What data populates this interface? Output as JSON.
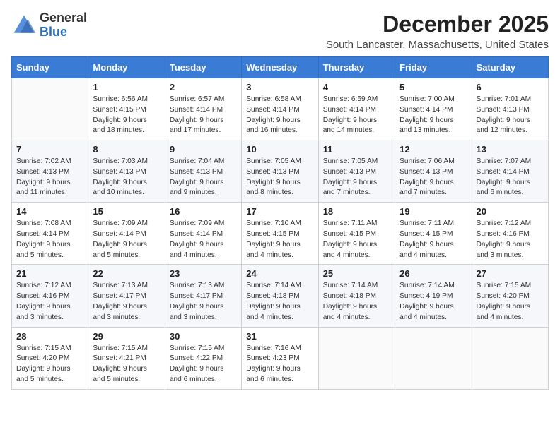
{
  "header": {
    "logo_general": "General",
    "logo_blue": "Blue",
    "month": "December 2025",
    "location": "South Lancaster, Massachusetts, United States"
  },
  "days_of_week": [
    "Sunday",
    "Monday",
    "Tuesday",
    "Wednesday",
    "Thursday",
    "Friday",
    "Saturday"
  ],
  "weeks": [
    [
      {
        "day": "",
        "sunrise": "",
        "sunset": "",
        "daylight": ""
      },
      {
        "day": "1",
        "sunrise": "Sunrise: 6:56 AM",
        "sunset": "Sunset: 4:15 PM",
        "daylight": "Daylight: 9 hours and 18 minutes."
      },
      {
        "day": "2",
        "sunrise": "Sunrise: 6:57 AM",
        "sunset": "Sunset: 4:14 PM",
        "daylight": "Daylight: 9 hours and 17 minutes."
      },
      {
        "day": "3",
        "sunrise": "Sunrise: 6:58 AM",
        "sunset": "Sunset: 4:14 PM",
        "daylight": "Daylight: 9 hours and 16 minutes."
      },
      {
        "day": "4",
        "sunrise": "Sunrise: 6:59 AM",
        "sunset": "Sunset: 4:14 PM",
        "daylight": "Daylight: 9 hours and 14 minutes."
      },
      {
        "day": "5",
        "sunrise": "Sunrise: 7:00 AM",
        "sunset": "Sunset: 4:14 PM",
        "daylight": "Daylight: 9 hours and 13 minutes."
      },
      {
        "day": "6",
        "sunrise": "Sunrise: 7:01 AM",
        "sunset": "Sunset: 4:13 PM",
        "daylight": "Daylight: 9 hours and 12 minutes."
      }
    ],
    [
      {
        "day": "7",
        "sunrise": "Sunrise: 7:02 AM",
        "sunset": "Sunset: 4:13 PM",
        "daylight": "Daylight: 9 hours and 11 minutes."
      },
      {
        "day": "8",
        "sunrise": "Sunrise: 7:03 AM",
        "sunset": "Sunset: 4:13 PM",
        "daylight": "Daylight: 9 hours and 10 minutes."
      },
      {
        "day": "9",
        "sunrise": "Sunrise: 7:04 AM",
        "sunset": "Sunset: 4:13 PM",
        "daylight": "Daylight: 9 hours and 9 minutes."
      },
      {
        "day": "10",
        "sunrise": "Sunrise: 7:05 AM",
        "sunset": "Sunset: 4:13 PM",
        "daylight": "Daylight: 9 hours and 8 minutes."
      },
      {
        "day": "11",
        "sunrise": "Sunrise: 7:05 AM",
        "sunset": "Sunset: 4:13 PM",
        "daylight": "Daylight: 9 hours and 7 minutes."
      },
      {
        "day": "12",
        "sunrise": "Sunrise: 7:06 AM",
        "sunset": "Sunset: 4:13 PM",
        "daylight": "Daylight: 9 hours and 7 minutes."
      },
      {
        "day": "13",
        "sunrise": "Sunrise: 7:07 AM",
        "sunset": "Sunset: 4:14 PM",
        "daylight": "Daylight: 9 hours and 6 minutes."
      }
    ],
    [
      {
        "day": "14",
        "sunrise": "Sunrise: 7:08 AM",
        "sunset": "Sunset: 4:14 PM",
        "daylight": "Daylight: 9 hours and 5 minutes."
      },
      {
        "day": "15",
        "sunrise": "Sunrise: 7:09 AM",
        "sunset": "Sunset: 4:14 PM",
        "daylight": "Daylight: 9 hours and 5 minutes."
      },
      {
        "day": "16",
        "sunrise": "Sunrise: 7:09 AM",
        "sunset": "Sunset: 4:14 PM",
        "daylight": "Daylight: 9 hours and 4 minutes."
      },
      {
        "day": "17",
        "sunrise": "Sunrise: 7:10 AM",
        "sunset": "Sunset: 4:15 PM",
        "daylight": "Daylight: 9 hours and 4 minutes."
      },
      {
        "day": "18",
        "sunrise": "Sunrise: 7:11 AM",
        "sunset": "Sunset: 4:15 PM",
        "daylight": "Daylight: 9 hours and 4 minutes."
      },
      {
        "day": "19",
        "sunrise": "Sunrise: 7:11 AM",
        "sunset": "Sunset: 4:15 PM",
        "daylight": "Daylight: 9 hours and 4 minutes."
      },
      {
        "day": "20",
        "sunrise": "Sunrise: 7:12 AM",
        "sunset": "Sunset: 4:16 PM",
        "daylight": "Daylight: 9 hours and 3 minutes."
      }
    ],
    [
      {
        "day": "21",
        "sunrise": "Sunrise: 7:12 AM",
        "sunset": "Sunset: 4:16 PM",
        "daylight": "Daylight: 9 hours and 3 minutes."
      },
      {
        "day": "22",
        "sunrise": "Sunrise: 7:13 AM",
        "sunset": "Sunset: 4:17 PM",
        "daylight": "Daylight: 9 hours and 3 minutes."
      },
      {
        "day": "23",
        "sunrise": "Sunrise: 7:13 AM",
        "sunset": "Sunset: 4:17 PM",
        "daylight": "Daylight: 9 hours and 3 minutes."
      },
      {
        "day": "24",
        "sunrise": "Sunrise: 7:14 AM",
        "sunset": "Sunset: 4:18 PM",
        "daylight": "Daylight: 9 hours and 4 minutes."
      },
      {
        "day": "25",
        "sunrise": "Sunrise: 7:14 AM",
        "sunset": "Sunset: 4:18 PM",
        "daylight": "Daylight: 9 hours and 4 minutes."
      },
      {
        "day": "26",
        "sunrise": "Sunrise: 7:14 AM",
        "sunset": "Sunset: 4:19 PM",
        "daylight": "Daylight: 9 hours and 4 minutes."
      },
      {
        "day": "27",
        "sunrise": "Sunrise: 7:15 AM",
        "sunset": "Sunset: 4:20 PM",
        "daylight": "Daylight: 9 hours and 4 minutes."
      }
    ],
    [
      {
        "day": "28",
        "sunrise": "Sunrise: 7:15 AM",
        "sunset": "Sunset: 4:20 PM",
        "daylight": "Daylight: 9 hours and 5 minutes."
      },
      {
        "day": "29",
        "sunrise": "Sunrise: 7:15 AM",
        "sunset": "Sunset: 4:21 PM",
        "daylight": "Daylight: 9 hours and 5 minutes."
      },
      {
        "day": "30",
        "sunrise": "Sunrise: 7:15 AM",
        "sunset": "Sunset: 4:22 PM",
        "daylight": "Daylight: 9 hours and 6 minutes."
      },
      {
        "day": "31",
        "sunrise": "Sunrise: 7:16 AM",
        "sunset": "Sunset: 4:23 PM",
        "daylight": "Daylight: 9 hours and 6 minutes."
      },
      {
        "day": "",
        "sunrise": "",
        "sunset": "",
        "daylight": ""
      },
      {
        "day": "",
        "sunrise": "",
        "sunset": "",
        "daylight": ""
      },
      {
        "day": "",
        "sunrise": "",
        "sunset": "",
        "daylight": ""
      }
    ]
  ]
}
